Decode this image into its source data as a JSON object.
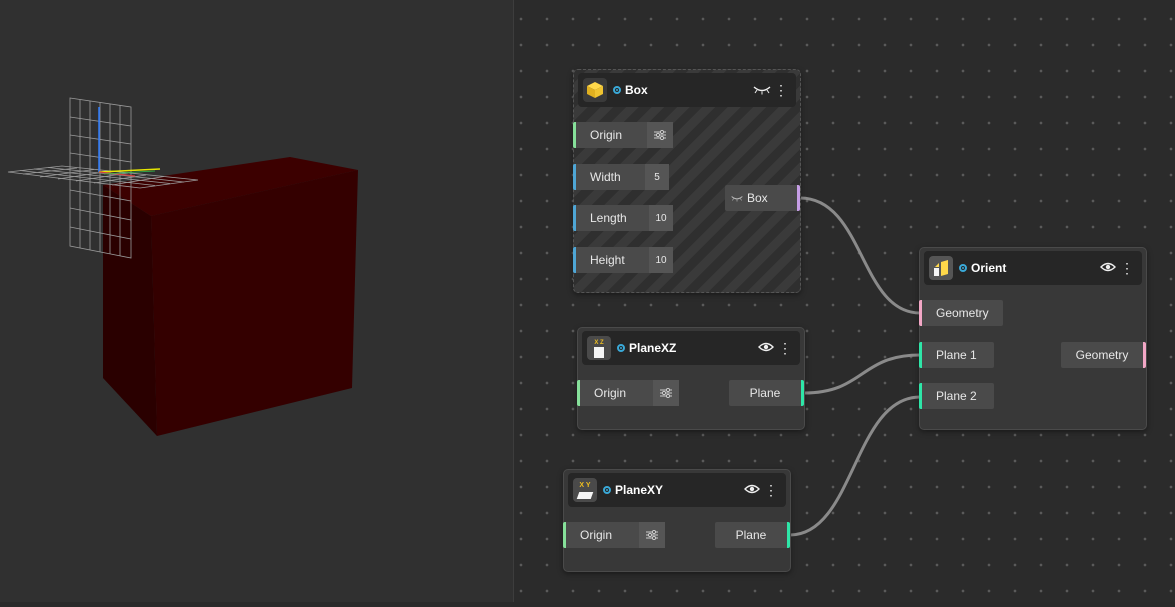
{
  "nodes": {
    "box": {
      "title": "Box",
      "inputs": [
        {
          "label": "Origin",
          "value": ""
        },
        {
          "label": "Width",
          "value": "5"
        },
        {
          "label": "Length",
          "value": "10"
        },
        {
          "label": "Height",
          "value": "10"
        }
      ],
      "output": "Box"
    },
    "planexz": {
      "title": "PlaneXZ",
      "icon_text": "X Z",
      "input": "Origin",
      "output": "Plane"
    },
    "planexy": {
      "title": "PlaneXY",
      "icon_text": "X Y",
      "input": "Origin",
      "output": "Plane"
    },
    "orient": {
      "title": "Orient",
      "inputs": [
        "Geometry",
        "Plane 1",
        "Plane 2"
      ],
      "output": "Geometry"
    }
  },
  "icons": {
    "hidden": "eye-closed-icon",
    "visible": "eye-icon",
    "menu": "kebab-menu-icon",
    "settings": "sliders-icon"
  },
  "colors": {
    "viewport_bg": "#303030",
    "graph_bg": "#2b2b2b",
    "box_geometry": "#3a0000",
    "number_port": "#4ea6d6",
    "vector_port": "#86e09a",
    "plane_port": "#2ee6a8",
    "geometry_port": "#f3a7c6",
    "box_output_port": "#c69ee6",
    "wire": "#8a8a8a"
  }
}
